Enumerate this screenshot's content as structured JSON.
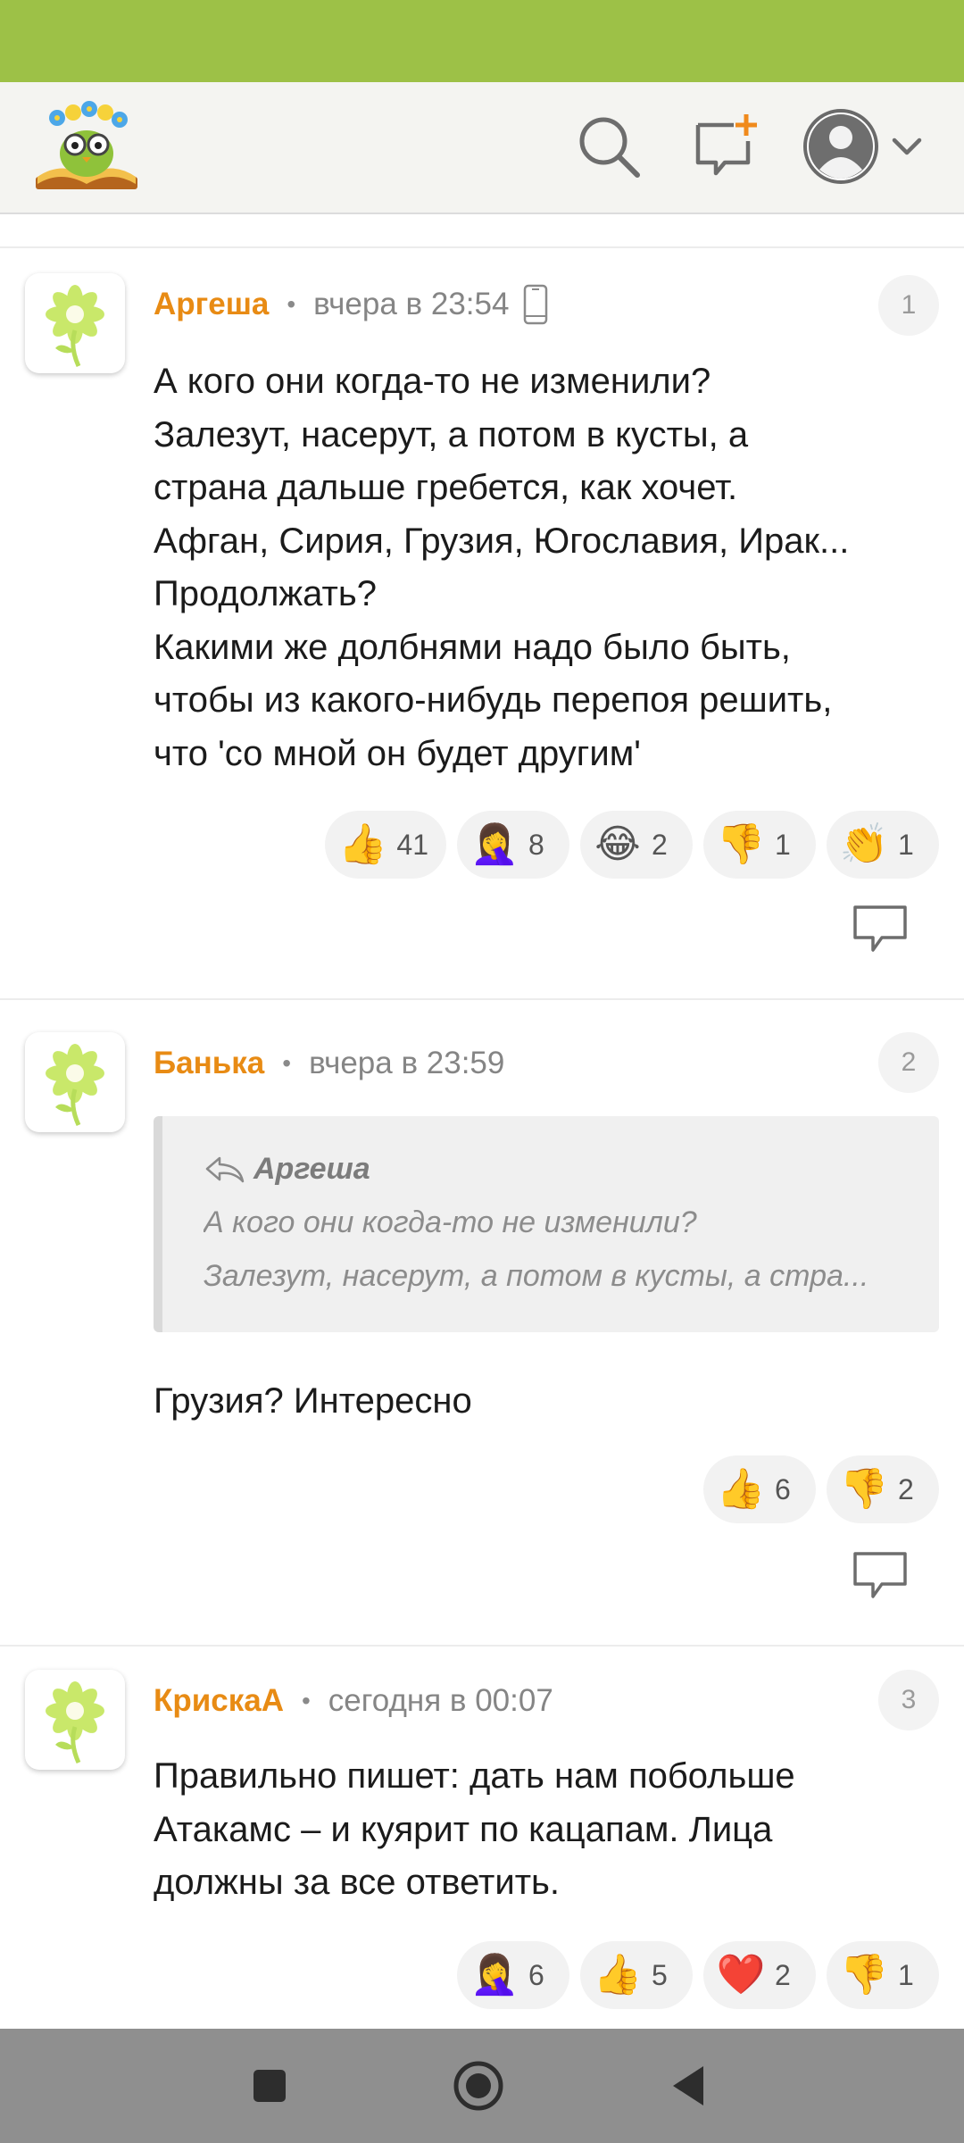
{
  "colors": {
    "status_bar": "#9dc147",
    "author": "#e88b14",
    "accent_plus": "#f08a1c"
  },
  "header": {
    "logo_icon": "owl-book-logo-icon",
    "search_icon": "search-icon",
    "new_post_icon": "add-comment-icon",
    "profile_icon": "user-avatar-icon",
    "dropdown_icon": "chevron-down-icon"
  },
  "comments": [
    {
      "number": "1",
      "author": "Аргеша",
      "time": "вчера в 23:54",
      "device_icon": "mobile-phone-icon",
      "text": "А кого они когда-то не изменили?\nЗалезут, насерут, а потом в кусты, а\nстрана дальше гребется, как хочет.\nАфган, Сирия, Грузия, Югославия, Ирак...\nПродолжать?\nКакими же долбнями надо было быть,\nчтобы из какого-нибудь перепоя решить,\nчто 'со мной он будет другим'",
      "reactions": [
        {
          "emoji": "👍",
          "icon": "thumbs-up-icon",
          "count": "41"
        },
        {
          "emoji": "🤦‍♀️",
          "icon": "facepalm-icon",
          "count": "8"
        },
        {
          "emoji": "😂",
          "icon": "laughing-tears-icon",
          "count": "2"
        },
        {
          "emoji": "👎",
          "icon": "thumbs-down-icon",
          "count": "1"
        },
        {
          "emoji": "👏",
          "icon": "clapping-icon",
          "count": "1"
        }
      ]
    },
    {
      "number": "2",
      "author": "Банька",
      "time": "вчера в 23:59",
      "quote": {
        "author": "Аргеша",
        "line1": "А кого они когда-то не изменили?",
        "line2": "Залезут, насерут, а потом в кусты, а стра..."
      },
      "text": "Грузия? Интересно",
      "reactions": [
        {
          "emoji": "👍",
          "icon": "thumbs-up-icon",
          "count": "6"
        },
        {
          "emoji": "👎",
          "icon": "thumbs-down-icon",
          "count": "2"
        }
      ]
    },
    {
      "number": "3",
      "author": "КрискаА",
      "time": "сегодня в 00:07",
      "text": "Правильно пишет: дать нам побольше\nАтакамс – и куярит по кацапам. Лица\nдолжны за все ответить.",
      "reactions": [
        {
          "emoji": "🤦‍♀️",
          "icon": "facepalm-icon",
          "count": "6"
        },
        {
          "emoji": "👍",
          "icon": "thumbs-up-icon",
          "count": "5"
        },
        {
          "emoji": "❤️",
          "icon": "heart-icon",
          "count": "2"
        },
        {
          "emoji": "👎",
          "icon": "thumbs-down-icon",
          "count": "1"
        }
      ]
    }
  ],
  "navigation": {
    "recents_icon": "square-recents-icon",
    "home_icon": "circle-home-icon",
    "back_icon": "triangle-back-icon"
  }
}
